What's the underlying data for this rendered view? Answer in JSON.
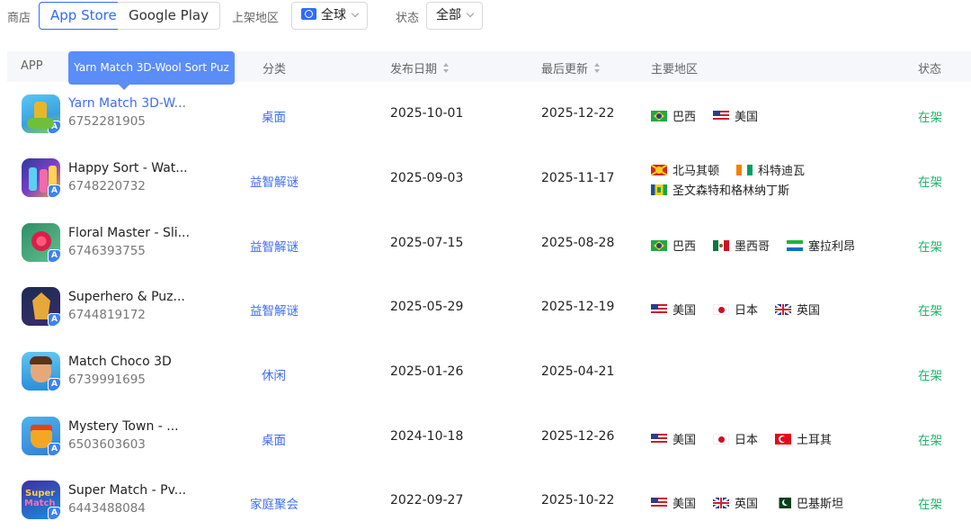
{
  "filters": {
    "store_label": "商店",
    "store_options": [
      "App Store",
      "Google Play"
    ],
    "store_selected": "App Store",
    "region_label": "上架地区",
    "region_value": "全球",
    "status_label": "状态",
    "status_value": "全部"
  },
  "table": {
    "columns": {
      "app": "APP",
      "category": "分类",
      "release_date": "发布日期",
      "last_update": "最后更新",
      "main_region": "主要地区",
      "status": "状态"
    },
    "tooltip": "Yarn Match 3D-Wool Sort Puz",
    "rows": [
      {
        "name": "Yarn Match 3D-W...",
        "id": "6752281905",
        "category": "桌面",
        "release_date": "2025-10-01",
        "last_update": "2025-12-22",
        "regions": [
          [
            {
              "flag": "br-flag",
              "name": "巴西"
            },
            {
              "flag": "us-flag",
              "name": "美国"
            }
          ]
        ],
        "status": "在架"
      },
      {
        "name": "Happy Sort - Wat...",
        "id": "6748220732",
        "category": "益智解谜",
        "release_date": "2025-09-03",
        "last_update": "2025-11-17",
        "regions": [
          [
            {
              "flag": "mk-flag",
              "name": "北马其顿"
            },
            {
              "flag": "ci-flag",
              "name": "科特迪瓦"
            }
          ],
          [
            {
              "flag": "vc-flag",
              "name": "圣文森特和格林纳丁斯"
            }
          ]
        ],
        "status": "在架"
      },
      {
        "name": "Floral Master - Sli...",
        "id": "6746393755",
        "category": "益智解谜",
        "release_date": "2025-07-15",
        "last_update": "2025-08-28",
        "regions": [
          [
            {
              "flag": "br-flag",
              "name": "巴西"
            },
            {
              "flag": "mx-flag",
              "name": "墨西哥"
            },
            {
              "flag": "sl-flag",
              "name": "塞拉利昂"
            }
          ]
        ],
        "status": "在架"
      },
      {
        "name": "Superhero & Puz...",
        "id": "6744819172",
        "category": "益智解谜",
        "release_date": "2025-05-29",
        "last_update": "2025-12-19",
        "regions": [
          [
            {
              "flag": "us-flag",
              "name": "美国"
            },
            {
              "flag": "jp-flag",
              "name": "日本"
            },
            {
              "flag": "gb-flag",
              "name": "英国"
            }
          ]
        ],
        "status": "在架"
      },
      {
        "name": "Match Choco 3D",
        "id": "6739991695",
        "category": "休闲",
        "release_date": "2025-01-26",
        "last_update": "2025-04-21",
        "regions": [],
        "status": "在架"
      },
      {
        "name": "Mystery Town - ...",
        "id": "6503603603",
        "category": "桌面",
        "release_date": "2024-10-18",
        "last_update": "2025-12-26",
        "regions": [
          [
            {
              "flag": "us-flag",
              "name": "美国"
            },
            {
              "flag": "jp-flag",
              "name": "日本"
            },
            {
              "flag": "tr-flag",
              "name": "土耳其"
            }
          ]
        ],
        "status": "在架"
      },
      {
        "name": "Super Match - Pv...",
        "id": "6443488084",
        "category": "家庭聚会",
        "release_date": "2022-09-27",
        "last_update": "2025-10-22",
        "regions": [
          [
            {
              "flag": "us-flag",
              "name": "美国"
            },
            {
              "flag": "gb-flag",
              "name": "英国"
            },
            {
              "flag": "pk-flag",
              "name": "巴基斯坦"
            }
          ]
        ],
        "status": "在架"
      }
    ]
  },
  "colors": {
    "accent": "#2f6bff",
    "link": "#3d6df5",
    "status_green": "#21b36b",
    "tooltip_bg": "#5a8df7",
    "header_bg": "#f5f7fa"
  }
}
